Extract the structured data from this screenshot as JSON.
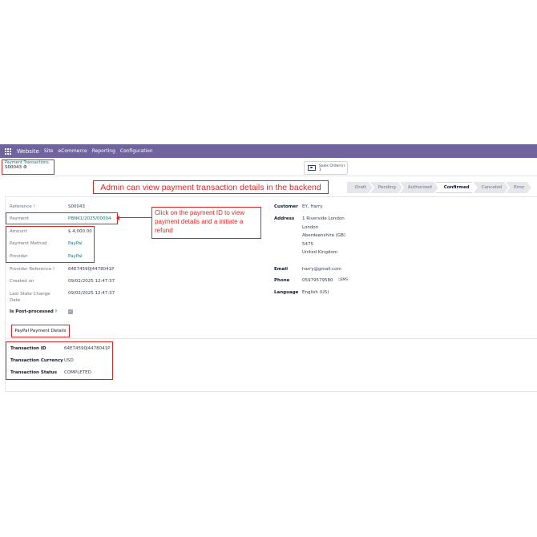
{
  "navbar": {
    "brand": "Website",
    "menu": [
      "Site",
      "eCommerce",
      "Reporting",
      "Configuration"
    ]
  },
  "breadcrumb": {
    "parent": "Payment Transactions",
    "record": "S00043"
  },
  "smart_button": {
    "line1": "Sales Order(s)",
    "line2": "1"
  },
  "banner": "Admin can view payment transaction details in the backend",
  "statusbar": [
    "Draft",
    "Pending",
    "Authorized",
    "Confirmed",
    "Canceled",
    "Error"
  ],
  "status_active": "Confirmed",
  "callout": "Click on the payment ID to view payment details and a initiate a refund",
  "left_fields": {
    "reference": {
      "label": "Reference",
      "value": "S00043"
    },
    "payment": {
      "label": "Payment",
      "value": "PBNK1/2025/00004"
    },
    "amount": {
      "label": "Amount",
      "value": "$ 4,000.00"
    },
    "payment_method": {
      "label": "Payment Method",
      "value": "PayPal"
    },
    "provider": {
      "label": "Provider",
      "value": "PayPal"
    },
    "provider_reference": {
      "label": "Provider Reference",
      "value": "64E74590J4478041P"
    },
    "created_on": {
      "label": "Created on",
      "value": "09/02/2025 12:47:37"
    },
    "last_state_change": {
      "label1": "Last State Change",
      "label2": "Date",
      "value": "09/02/2025 12:47:37"
    },
    "post_processed": {
      "label": "Is Post-processed"
    }
  },
  "right_fields": {
    "customer": {
      "label": "Customer",
      "value": "EY, Harry"
    },
    "address": {
      "label": "Address",
      "lines": [
        "1 Riverside London",
        "London",
        "Aberdeenshire (GB)",
        "5475",
        "United Kingdom"
      ]
    },
    "email": {
      "label": "Email",
      "value": "harry@gmail.com"
    },
    "phone": {
      "label": "Phone",
      "value": "05979579580",
      "sms": "SMS"
    },
    "language": {
      "label": "Language",
      "value": "English (US)"
    }
  },
  "tab": "PayPal Payment Details",
  "details": {
    "transaction_id": {
      "label": "Transaction ID",
      "value": "64E74590J4478041P"
    },
    "transaction_currency": {
      "label": "Transaction Currency",
      "value": "USD"
    },
    "transaction_status": {
      "label": "Transaction Status",
      "value": "COMPLETED"
    }
  },
  "colors": {
    "navbar": "#71639e",
    "link": "#017e84",
    "annotation": "#dc2626"
  }
}
